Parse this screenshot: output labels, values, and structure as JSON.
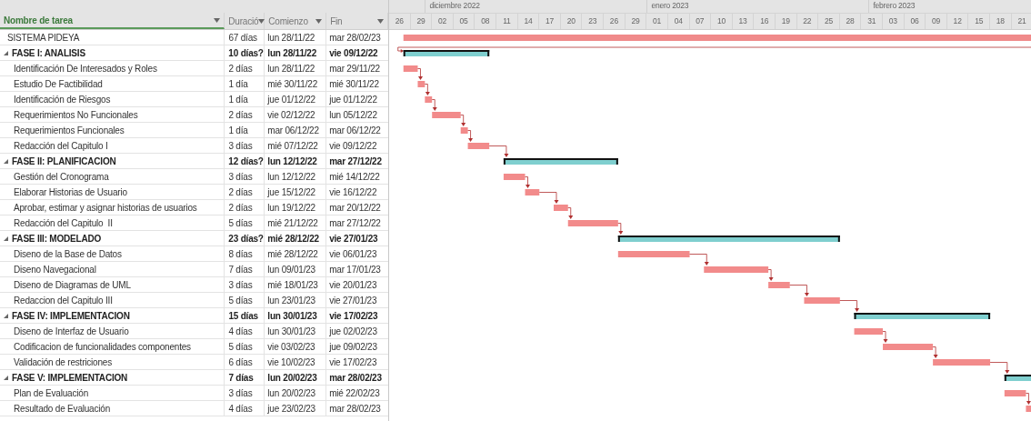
{
  "table": {
    "columns": [
      {
        "label": "Nombre de tarea",
        "selected": true
      },
      {
        "label": "Duració",
        "selected": false
      },
      {
        "label": "Comienzo",
        "selected": false
      },
      {
        "label": "Fin",
        "selected": false
      }
    ],
    "rows": [
      {
        "kind": "project",
        "name": "SISTEMA PIDEYA",
        "duration": "67 días",
        "start": "lun 28/11/22",
        "finish": "mar 28/02/23"
      },
      {
        "kind": "summary",
        "expanded": true,
        "name": "FASE I: ANALISIS",
        "duration": "10 días?",
        "start": "lun 28/11/22",
        "finish": "vie 09/12/22"
      },
      {
        "kind": "task",
        "name": "Identificación De Interesados y Roles",
        "duration": "2 días",
        "start": "lun 28/11/22",
        "finish": "mar 29/11/22"
      },
      {
        "kind": "task",
        "name": "Estudio De Factibilidad",
        "duration": "1 día",
        "start": "mié 30/11/22",
        "finish": "mié 30/11/22"
      },
      {
        "kind": "task",
        "name": "Identificación de Riesgos",
        "duration": "1 día",
        "start": "jue 01/12/22",
        "finish": "jue 01/12/22"
      },
      {
        "kind": "task",
        "name": "Requerimientos No Funcionales",
        "duration": "2 días",
        "start": "vie 02/12/22",
        "finish": "lun 05/12/22"
      },
      {
        "kind": "task",
        "name": "Requerimientos Funcionales",
        "duration": "1 día",
        "start": "mar 06/12/22",
        "finish": "mar 06/12/22"
      },
      {
        "kind": "task",
        "name": "Redacción del Capitulo I",
        "duration": "3 días",
        "start": "mié 07/12/22",
        "finish": "vie 09/12/22"
      },
      {
        "kind": "summary",
        "expanded": true,
        "name": "FASE II: PLANIFICACION",
        "duration": "12 días?",
        "start": "lun 12/12/22",
        "finish": "mar 27/12/22"
      },
      {
        "kind": "task",
        "name": "Gestión del Cronograma",
        "duration": "3 días",
        "start": "lun 12/12/22",
        "finish": "mié 14/12/22"
      },
      {
        "kind": "task",
        "name": "Elaborar Historias de Usuario",
        "duration": "2 días",
        "start": "jue 15/12/22",
        "finish": "vie 16/12/22"
      },
      {
        "kind": "task",
        "name": "Aprobar, estimar y asignar historias de usuarios",
        "duration": "2 días",
        "start": "lun 19/12/22",
        "finish": "mar 20/12/22"
      },
      {
        "kind": "task",
        "name": "Redacción del Capitulo  II",
        "duration": "5 días",
        "start": "mié 21/12/22",
        "finish": "mar 27/12/22"
      },
      {
        "kind": "summary",
        "expanded": true,
        "name": "FASE III: MODELADO",
        "duration": "23 días?",
        "start": "mié 28/12/22",
        "finish": "vie 27/01/23"
      },
      {
        "kind": "task",
        "name": "Diseno de la Base de Datos",
        "duration": "8 días",
        "start": "mié 28/12/22",
        "finish": "vie 06/01/23"
      },
      {
        "kind": "task",
        "name": "Diseno Navegacional",
        "duration": "7 días",
        "start": "lun 09/01/23",
        "finish": "mar 17/01/23"
      },
      {
        "kind": "task",
        "name": "Diseno de Diagramas de UML",
        "duration": "3 días",
        "start": "mié 18/01/23",
        "finish": "vie 20/01/23"
      },
      {
        "kind": "task",
        "name": "Redaccion del Capitulo III",
        "duration": "5 días",
        "start": "lun 23/01/23",
        "finish": "vie 27/01/23"
      },
      {
        "kind": "summary",
        "expanded": true,
        "name": "FASE IV: IMPLEMENTACION",
        "duration": "15 días",
        "start": "lun 30/01/23",
        "finish": "vie 17/02/23"
      },
      {
        "kind": "task",
        "name": "Diseno de Interfaz de Usuario",
        "duration": "4 días",
        "start": "lun 30/01/23",
        "finish": "jue 02/02/23"
      },
      {
        "kind": "task",
        "name": "Codificacion de funcionalidades componentes",
        "duration": "5 días",
        "start": "vie 03/02/23",
        "finish": "jue 09/02/23"
      },
      {
        "kind": "task",
        "name": "Validación de restriciones",
        "duration": "6 días",
        "start": "vie 10/02/23",
        "finish": "vie 17/02/23"
      },
      {
        "kind": "summary",
        "expanded": true,
        "name": "FASE V: IMPLEMENTACION",
        "duration": "7 días",
        "start": "lun 20/02/23",
        "finish": "mar 28/02/23"
      },
      {
        "kind": "task",
        "name": "Plan de Evaluación",
        "duration": "3 días",
        "start": "lun 20/02/23",
        "finish": "mié 22/02/23"
      },
      {
        "kind": "task",
        "name": "Resultado de Evaluación",
        "duration": "4 días",
        "start": "jue 23/02/23",
        "finish": "mar 28/02/23"
      }
    ]
  },
  "timeline": {
    "months": [
      "diciembre 2022",
      "enero 2023",
      "febrero 2023"
    ],
    "days": [
      "26",
      "29",
      "02",
      "05",
      "08",
      "11",
      "14",
      "17",
      "20",
      "23",
      "26",
      "29",
      "01",
      "04",
      "07",
      "10",
      "13",
      "16",
      "19",
      "22",
      "25",
      "28",
      "31",
      "03",
      "06",
      "09",
      "12",
      "15",
      "18",
      "21"
    ]
  }
}
